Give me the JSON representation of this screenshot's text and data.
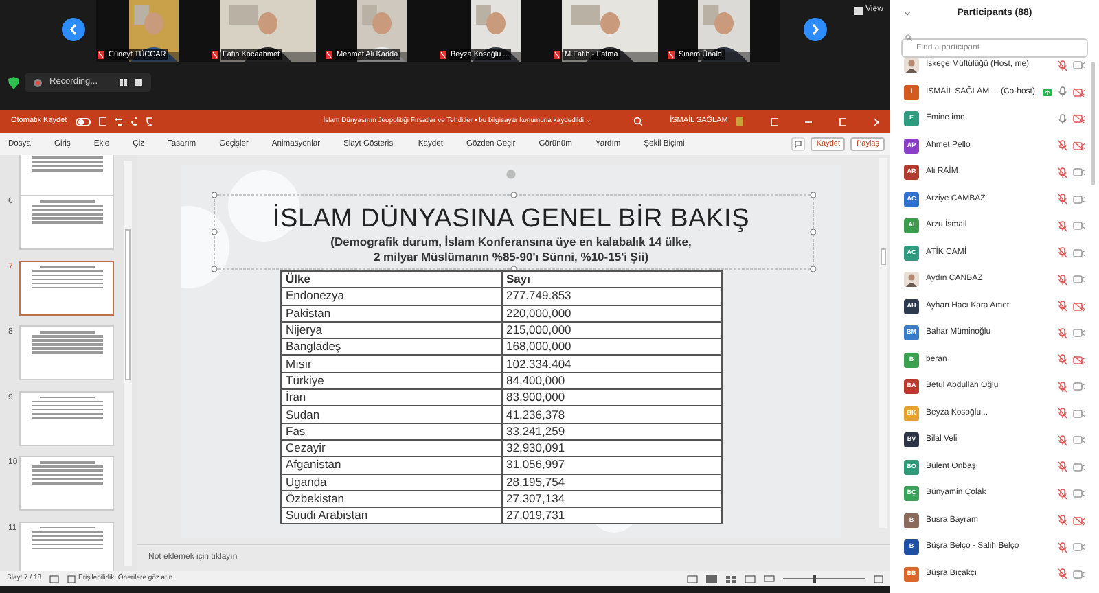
{
  "video_strip": {
    "view_label": "View",
    "tiles": [
      {
        "name": "Cüneyt TÜCCAR"
      },
      {
        "name": "Fatih Kocaahmet"
      },
      {
        "name": "Mehmet Ali Kadda"
      },
      {
        "name": "Beyza Kosoğlu ..."
      },
      {
        "name": "M.Fatih - Fatma"
      },
      {
        "name": "Sinem Ünaldı"
      }
    ]
  },
  "recording": {
    "label": "Recording..."
  },
  "powerpoint": {
    "autosave_label": "Otomatik Kaydet",
    "autosave_on": false,
    "title": "İslam Dünyasının Jeopolitiği Fırsatlar ve Tehditler • bu bilgisayar konumuna kaydedildi ⌄",
    "user": "İSMAİL SAĞLAM",
    "menu": [
      "Dosya",
      "Giriş",
      "Ekle",
      "Çiz",
      "Tasarım",
      "Geçişler",
      "Animasyonlar",
      "Slayt Gösterisi",
      "Kaydet",
      "Gözden Geçir",
      "Görünüm",
      "Yardım",
      "Şekil Biçimi"
    ],
    "record_button": "Kaydet",
    "share_button": "Paylaş",
    "thumbnails": [
      {
        "selected": false
      },
      {
        "number": "6",
        "selected": false
      },
      {
        "number": "7",
        "selected": true
      },
      {
        "number": "8",
        "selected": false
      },
      {
        "number": "9",
        "selected": false
      },
      {
        "number": "10",
        "selected": false
      },
      {
        "number": "11",
        "selected": false
      }
    ],
    "slide": {
      "title": "İSLAM DÜNYASINA GENEL BİR BAKIŞ",
      "subtitle_lines": [
        "(Demografik durum, İslam Konferansına üye en kalabalık 14 ülke,",
        "2 milyar Müslümanın %85-90'ı Sünni, %10-15'i Şii)"
      ],
      "table": {
        "columns": [
          "Ülke",
          "Sayı"
        ],
        "rows": [
          [
            "Endonezya",
            "277.749.853"
          ],
          [
            "Pakistan",
            "220,000,000"
          ],
          [
            "Nijerya",
            "215,000,000"
          ],
          [
            "Bangladeş",
            "168,000,000"
          ],
          [
            "Mısır",
            "102.334.404"
          ],
          [
            "Türkiye",
            "84,400,000"
          ],
          [
            "İran",
            "83,900,000"
          ],
          [
            "Sudan",
            "41,236,378"
          ],
          [
            "Fas",
            "33,241,259"
          ],
          [
            "Cezayir",
            "32,930,091"
          ],
          [
            "Afganistan",
            "31,056,997"
          ],
          [
            "Uganda",
            "28,195,754"
          ],
          [
            "Özbekistan",
            "27,307,134"
          ],
          [
            "Suudi Arabistan",
            "27,019,731"
          ]
        ]
      }
    },
    "notes_placeholder": "Not eklemek için tıklayın",
    "status": {
      "slide_counter": "Slayt 7 / 18",
      "accessibility": "Erişilebilirlik: Önerilere göz atın",
      "zoom": {
        "level": 0.38
      }
    }
  },
  "participants": {
    "title": "Participants (88)",
    "search_placeholder": "Find a participant",
    "items": [
      {
        "name": "İskeçe Müftülüğü (Host, me)",
        "mic_muted": true,
        "video_stopped": false
      },
      {
        "name": "İSMAİL SAĞLAM ... (Co-host)",
        "initials": "İ",
        "color": "#d35b1f",
        "mic_muted": false,
        "video_stopped": true,
        "sharing": true
      },
      {
        "name": "Emine imn",
        "initials": "E",
        "color": "#2e9c7e",
        "mic_muted": false,
        "video_stopped": true
      },
      {
        "name": "Ahmet Pello",
        "initials": "AP",
        "color": "#8a3fc6",
        "mic_muted": true,
        "video_stopped": true
      },
      {
        "name": "Ali RAİM",
        "initials": "AR",
        "color": "#b33a2e",
        "mic_muted": true,
        "video_stopped": false
      },
      {
        "name": "Arziye CAMBAZ",
        "initials": "AC",
        "color": "#2f6fd0",
        "mic_muted": true,
        "video_stopped": false
      },
      {
        "name": "Arzu İsmail",
        "initials": "AI",
        "color": "#3b9c4e",
        "mic_muted": true,
        "video_stopped": false
      },
      {
        "name": "ATİK CAMİ",
        "initials": "AC",
        "color": "#2f9a7e",
        "mic_muted": true,
        "video_stopped": false
      },
      {
        "name": "Aydın CANBAZ",
        "mic_muted": true,
        "video_stopped": false
      },
      {
        "name": "Ayhan Hacı Kara Amet",
        "initials": "AH",
        "color": "#2d3a4e",
        "mic_muted": true,
        "video_stopped": true
      },
      {
        "name": "Bahar Müminoğlu",
        "initials": "BM",
        "color": "#3a7cc9",
        "mic_muted": true,
        "video_stopped": false
      },
      {
        "name": "beran",
        "initials": "B",
        "color": "#3ba050",
        "mic_muted": true,
        "video_stopped": true
      },
      {
        "name": "Betül Abdullah Oğlu",
        "initials": "BA",
        "color": "#b83a2f",
        "mic_muted": true,
        "video_stopped": false
      },
      {
        "name": "Beyza Kosoğlu...",
        "initials": "BK",
        "color": "#e3a32c",
        "mic_muted": true,
        "video_stopped": false
      },
      {
        "name": "Bilal Veli",
        "initials": "BV",
        "color": "#2c3446",
        "mic_muted": true,
        "video_stopped": false
      },
      {
        "name": "Bülent Onbaşı",
        "initials": "BO",
        "color": "#2e9a78",
        "mic_muted": true,
        "video_stopped": false
      },
      {
        "name": "Bünyamin Çolak",
        "initials": "BÇ",
        "color": "#3aa35a",
        "mic_muted": true,
        "video_stopped": false
      },
      {
        "name": "Busra Bayram",
        "initials": "B",
        "color": "#8a6a5a",
        "mic_muted": true,
        "video_stopped": true
      },
      {
        "name": "Büşra Belço - Salih Belço",
        "initials": "B",
        "color": "#1f4fa0",
        "mic_muted": true,
        "video_stopped": false
      },
      {
        "name": "Büşra Bıçakçı",
        "initials": "BB",
        "color": "#d9662a",
        "mic_muted": true,
        "video_stopped": false
      }
    ]
  }
}
